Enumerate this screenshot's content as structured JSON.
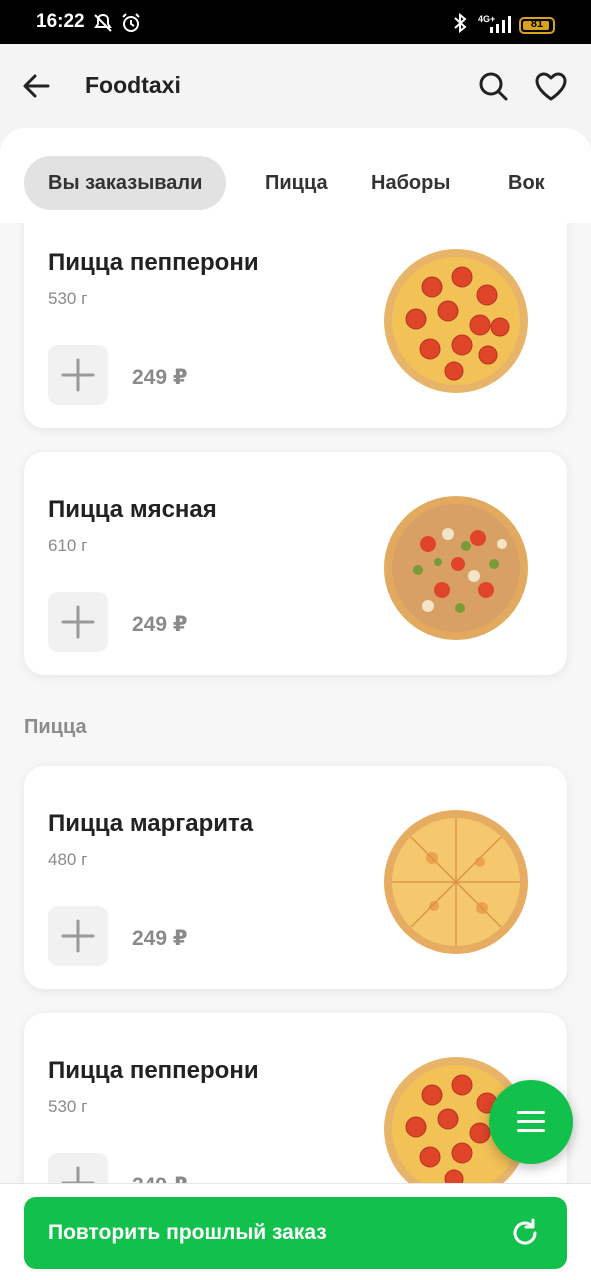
{
  "status": {
    "time": "16:22",
    "network": "4G+",
    "battery": "81"
  },
  "appbar": {
    "title": "Foodtaxi",
    "back_icon": "arrow-left-icon",
    "search_icon": "search-icon",
    "favorite_icon": "heart-icon"
  },
  "tabs": [
    {
      "label": "Вы заказывали",
      "active": true
    },
    {
      "label": "Пицца",
      "active": false
    },
    {
      "label": "Наборы",
      "active": false
    },
    {
      "label": "Вок",
      "active": false
    }
  ],
  "ordered": [
    {
      "name": "Пицца пепперони",
      "weight": "530 г",
      "price": "249 ₽",
      "image": "pepperoni"
    },
    {
      "name": "Пицца мясная",
      "weight": "610 г",
      "price": "249 ₽",
      "image": "meat"
    }
  ],
  "pizza_section": {
    "title": "Пицца",
    "items": [
      {
        "name": "Пицца маргарита",
        "weight": "480 г",
        "price": "249 ₽",
        "image": "margarita"
      },
      {
        "name": "Пицца пепперони",
        "weight": "530 г",
        "price": "249 ₽",
        "image": "pepperoni"
      }
    ]
  },
  "cta": {
    "label": "Повторить прошлый заказ",
    "icon": "refresh-icon"
  },
  "fab": {
    "icon": "menu-icon"
  },
  "colors": {
    "accent": "#11c14c",
    "tab_active_bg": "#e2e2e2",
    "price": "#8a8a8a"
  }
}
